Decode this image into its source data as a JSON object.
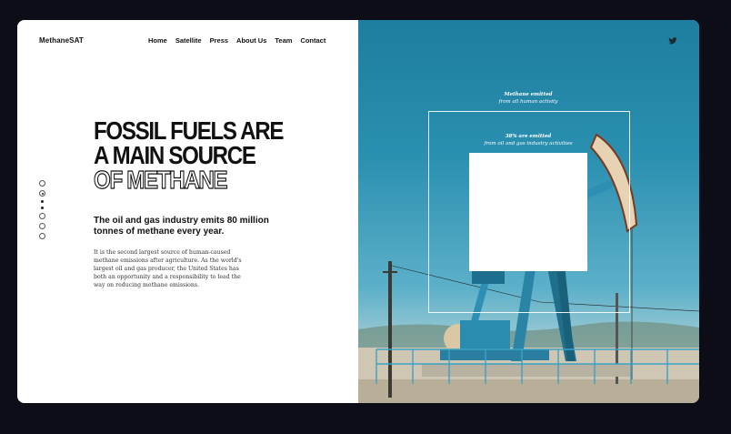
{
  "brand": {
    "name": "MethaneSAT"
  },
  "nav": {
    "items": [
      "Home",
      "Satellite",
      "Press",
      "About Us",
      "Team",
      "Contact"
    ]
  },
  "hero": {
    "line1": "FOSSIL FUELS ARE",
    "line2": "A MAIN SOURCE",
    "line3": "OF METHANE"
  },
  "subhead": "The oil and gas industry emits 80 million tonnes of methane every year.",
  "body": "It is the second largest source of human-caused methane emissions after agriculture. As the world's largest oil and gas producer, the United States has both an opportunity and a responsibility to lead the way on reducing methane emissions.",
  "graphic": {
    "outer_title": "Methane emitted",
    "outer_sub": "from all human activity",
    "inner_title": "38% are emitted",
    "inner_sub": "from oil and gas industry activities",
    "inner_share": 0.38
  },
  "social": {
    "icon": "twitter-icon"
  },
  "pagination": {
    "count": 6,
    "active": 1
  }
}
